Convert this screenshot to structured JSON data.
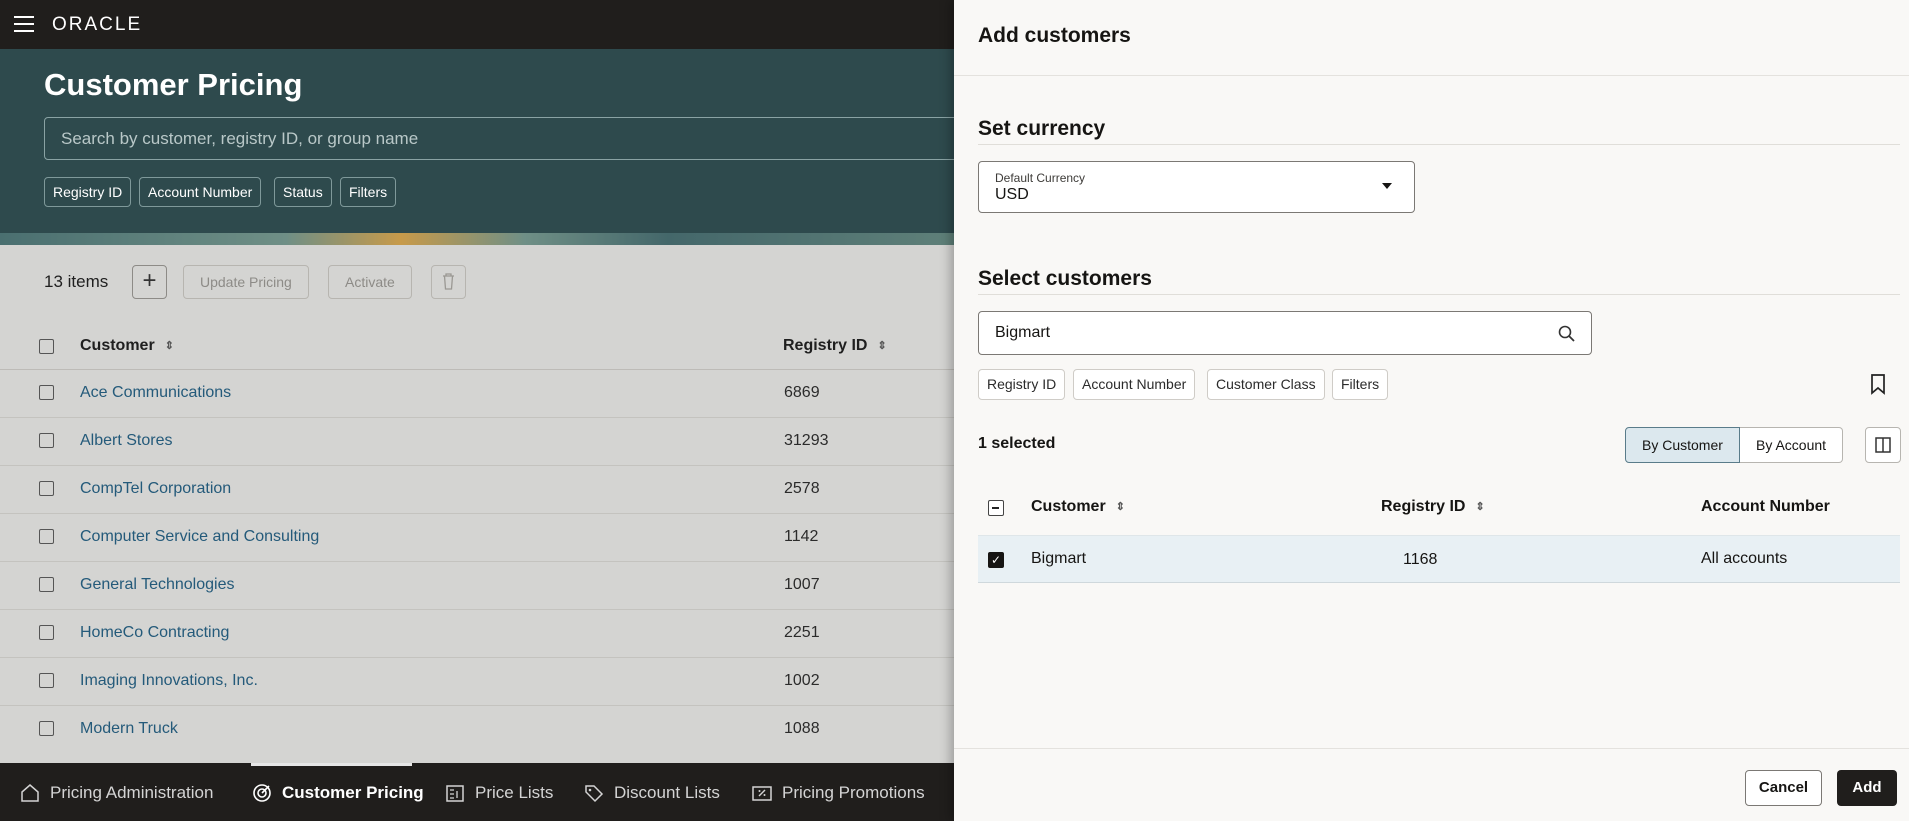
{
  "app": {
    "logo": "ORACLE"
  },
  "page": {
    "title": "Customer Pricing",
    "search_placeholder": "Search by customer, registry ID, or group name",
    "filter_chips": [
      "Registry ID",
      "Account Number",
      "Status",
      "Filters"
    ],
    "item_count": "13 items",
    "toolbar": {
      "update_pricing": "Update Pricing",
      "activate": "Activate"
    },
    "columns": {
      "customer": "Customer",
      "registry_id": "Registry ID"
    },
    "rows": [
      {
        "customer": "Ace Communications",
        "registry_id": "6869"
      },
      {
        "customer": "Albert Stores",
        "registry_id": "31293"
      },
      {
        "customer": "CompTel Corporation",
        "registry_id": "2578"
      },
      {
        "customer": "Computer Service and Consulting",
        "registry_id": "1142"
      },
      {
        "customer": "General Technologies",
        "registry_id": "1007"
      },
      {
        "customer": "HomeCo Contracting",
        "registry_id": "2251"
      },
      {
        "customer": "Imaging Innovations, Inc.",
        "registry_id": "1002"
      },
      {
        "customer": "Modern Truck",
        "registry_id": "1088"
      }
    ]
  },
  "bottom_nav": [
    {
      "label": "Pricing Administration",
      "icon": "home-icon"
    },
    {
      "label": "Customer Pricing",
      "icon": "target-icon",
      "active": true
    },
    {
      "label": "Price Lists",
      "icon": "price-list-icon"
    },
    {
      "label": "Discount Lists",
      "icon": "tag-icon"
    },
    {
      "label": "Pricing Promotions",
      "icon": "promotion-icon"
    }
  ],
  "drawer": {
    "title": "Add customers",
    "currency_section": "Set currency",
    "currency_label": "Default Currency",
    "currency_value": "USD",
    "customers_section": "Select customers",
    "search_value": "Bigmart",
    "chips": [
      "Registry ID",
      "Account Number",
      "Customer Class",
      "Filters"
    ],
    "selected_count": "1 selected",
    "view_toggle": {
      "by_customer": "By Customer",
      "by_account": "By Account",
      "selected": "By Customer"
    },
    "columns": {
      "customer": "Customer",
      "registry_id": "Registry ID",
      "account_number": "Account Number"
    },
    "rows": [
      {
        "customer": "Bigmart",
        "registry_id": "1168",
        "account_number": "All accounts",
        "checked": true
      }
    ],
    "cancel": "Cancel",
    "add": "Add"
  },
  "colors": {
    "topbar": "#201e1c",
    "hero": "#2e4a4d",
    "link": "#245a7a",
    "selected_row": "#e8f0f4"
  }
}
